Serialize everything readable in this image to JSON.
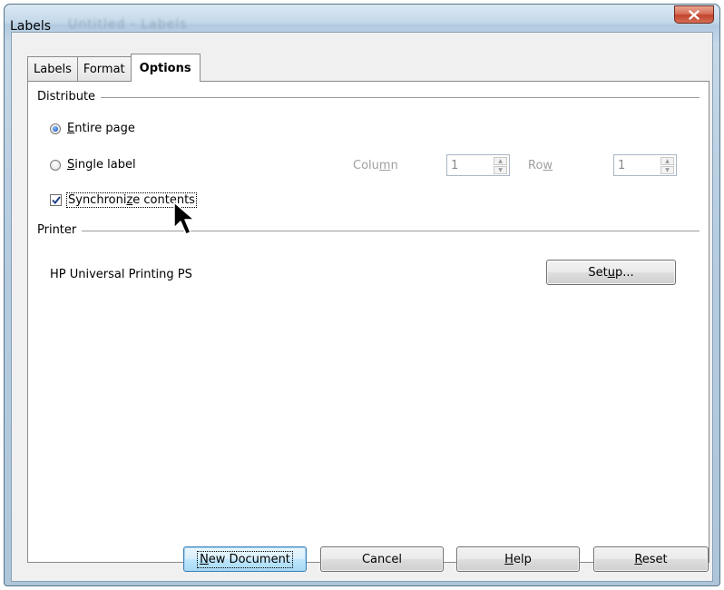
{
  "window": {
    "title": "Labels",
    "ghost_title": "Untitled - Labels",
    "close_icon": "close-icon"
  },
  "tabs": [
    {
      "label": "Labels",
      "active": false
    },
    {
      "label": "Format",
      "active": false
    },
    {
      "label": "Options",
      "active": true
    }
  ],
  "distribute": {
    "heading": "Distribute",
    "entire_page": {
      "pre": "",
      "key": "E",
      "post": "ntire page",
      "checked": true
    },
    "single_label": {
      "pre": "",
      "key": "S",
      "post": "ingle label",
      "checked": false
    },
    "column": {
      "pre": "Colu",
      "key": "m",
      "post": "n",
      "value": "1"
    },
    "row": {
      "pre": "Ro",
      "key": "w",
      "post": "",
      "value": "1"
    },
    "synchronize": {
      "pre": "Synchroni",
      "key": "z",
      "post": "e contents",
      "checked": true
    }
  },
  "printer": {
    "heading": "Printer",
    "name": "HP Universal Printing PS",
    "setup": {
      "pre": "Set",
      "key": "u",
      "post": "p..."
    }
  },
  "footer": {
    "new_document": {
      "pre": "",
      "key": "N",
      "post": "ew Document"
    },
    "cancel": {
      "label": "Cancel"
    },
    "help": {
      "pre": "",
      "key": "H",
      "post": "elp"
    },
    "reset": {
      "pre": "",
      "key": "R",
      "post": "eset"
    }
  },
  "colors": {
    "accent": "#3c7fb1",
    "close_red": "#c2432b",
    "checkmark": "#1f3f8a"
  }
}
